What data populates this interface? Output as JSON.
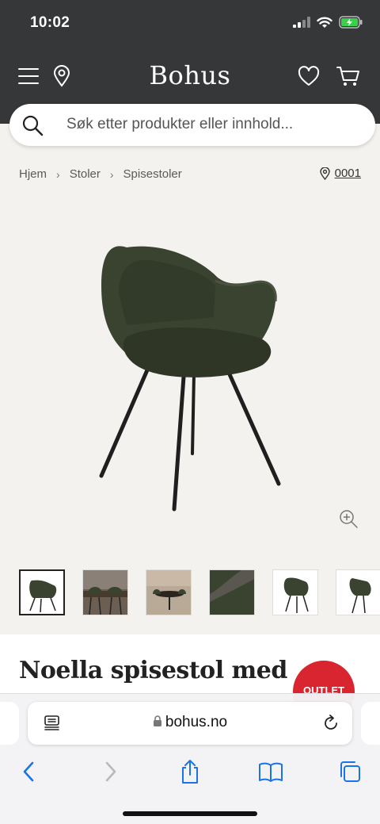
{
  "status": {
    "time": "10:02"
  },
  "header": {
    "logo": "Bohus"
  },
  "search": {
    "placeholder": "Søk etter produkter eller innhold..."
  },
  "breadcrumb": {
    "items": [
      "Hjem",
      "Stoler",
      "Spisestoler"
    ]
  },
  "store": {
    "code": "0001"
  },
  "product": {
    "title": "Noella spisestol med",
    "badge": "OUTLET",
    "chair_color": "#3b4330",
    "thumbnail_count": 6,
    "selected_thumbnail": 1
  },
  "browser": {
    "url": "bohus.no"
  },
  "colors": {
    "header_bg": "#363739",
    "badge": "#d9252f",
    "ios_blue": "#1a73e8"
  },
  "icons": [
    "menu-icon",
    "location-pin-icon",
    "heart-icon",
    "cart-icon",
    "search-icon",
    "zoom-in-icon",
    "lock-icon",
    "reload-icon",
    "back-icon",
    "forward-icon",
    "share-icon",
    "bookmarks-icon",
    "tabs-icon"
  ]
}
